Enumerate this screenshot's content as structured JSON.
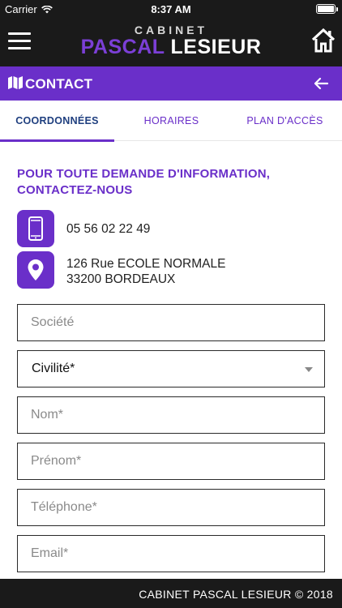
{
  "status_bar": {
    "carrier": "Carrier",
    "time": "8:37 AM"
  },
  "header": {
    "logo_top": "CABINET",
    "logo_first": "PASCAL",
    "logo_last": "LESIEUR",
    "icons": {
      "menu": "hamburger-icon",
      "home": "home-icon"
    }
  },
  "section": {
    "title": "CONTACT",
    "icons": {
      "left": "map-icon",
      "right": "arrow-left-icon"
    }
  },
  "tabs": [
    {
      "label": "COORDONNÉES",
      "active": true
    },
    {
      "label": "HORAIRES",
      "active": false
    },
    {
      "label": "PLAN D'ACCÈS",
      "active": false
    }
  ],
  "intro": {
    "line1": "POUR TOUTE DEMANDE D'INFORMATION,",
    "line2": "CONTACTEZ-NOUS"
  },
  "contact": {
    "phone": "05 56 02 22 49",
    "address_line1": "126 Rue ECOLE NORMALE",
    "address_line2": "33200 BORDEAUX"
  },
  "form": {
    "societe_placeholder": "Société",
    "civilite_value": "Civilité*",
    "nom_placeholder": "Nom*",
    "prenom_placeholder": "Prénom*",
    "telephone_placeholder": "Téléphone*",
    "email_placeholder": "Email*"
  },
  "footer": {
    "text": "CABINET PASCAL LESIEUR © 2018"
  },
  "colors": {
    "accent": "#6a2fc9",
    "dark": "#1a1a1a",
    "tab_active": "#1f3f7f"
  }
}
